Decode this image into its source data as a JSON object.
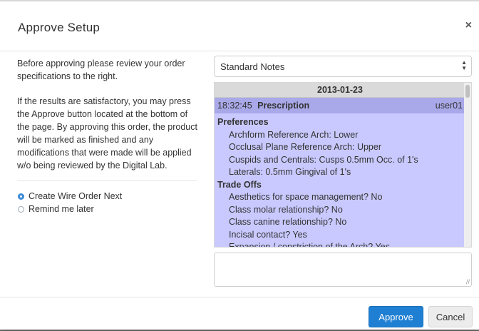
{
  "dialog": {
    "title": "Approve Setup",
    "close_label": "×"
  },
  "left": {
    "intro": "Before approving please review your order specifications to the right.",
    "body": "If the results are satisfactory, you may press the Approve button located at the bottom of the page. By approving this order, the product will be marked as finished and any modifications that were made will be applied w/o being reviewed by the Digital Lab.",
    "options": [
      {
        "label": "Create Wire Order Next",
        "checked": true
      },
      {
        "label": "Remind me later",
        "checked": false
      }
    ]
  },
  "notes_select": {
    "value": "Standard Notes",
    "arrows": "▲▼"
  },
  "notes": {
    "date": "2013-01-23",
    "entry": {
      "time": "18:32:45",
      "title": "Prescription",
      "user": "user01"
    },
    "sections": [
      {
        "title": "Preferences",
        "lines": [
          "Archform Reference Arch: Lower",
          "Occlusal Plane Reference Arch: Upper",
          "Cuspids and Centrals: Cusps 0.5mm Occ. of 1's",
          "Laterals: 0.5mm Gingival of 1's"
        ]
      },
      {
        "title": "Trade Offs",
        "lines": [
          "Aesthetics for space management? No",
          "Class molar relationship? No",
          "Class canine relationship? No",
          "Incisal contact? Yes",
          "Expansion / constriction of the Arch? Yes"
        ]
      }
    ]
  },
  "comment_box": {
    "value": "",
    "grip": "//"
  },
  "footer": {
    "approve_label": "Approve",
    "cancel_label": "Cancel"
  },
  "colors": {
    "primary": "#1f7fd3",
    "notes_bg": "#c9c9ff",
    "entry_bg": "#a9a9e9",
    "radio": "#3b8ad6"
  }
}
